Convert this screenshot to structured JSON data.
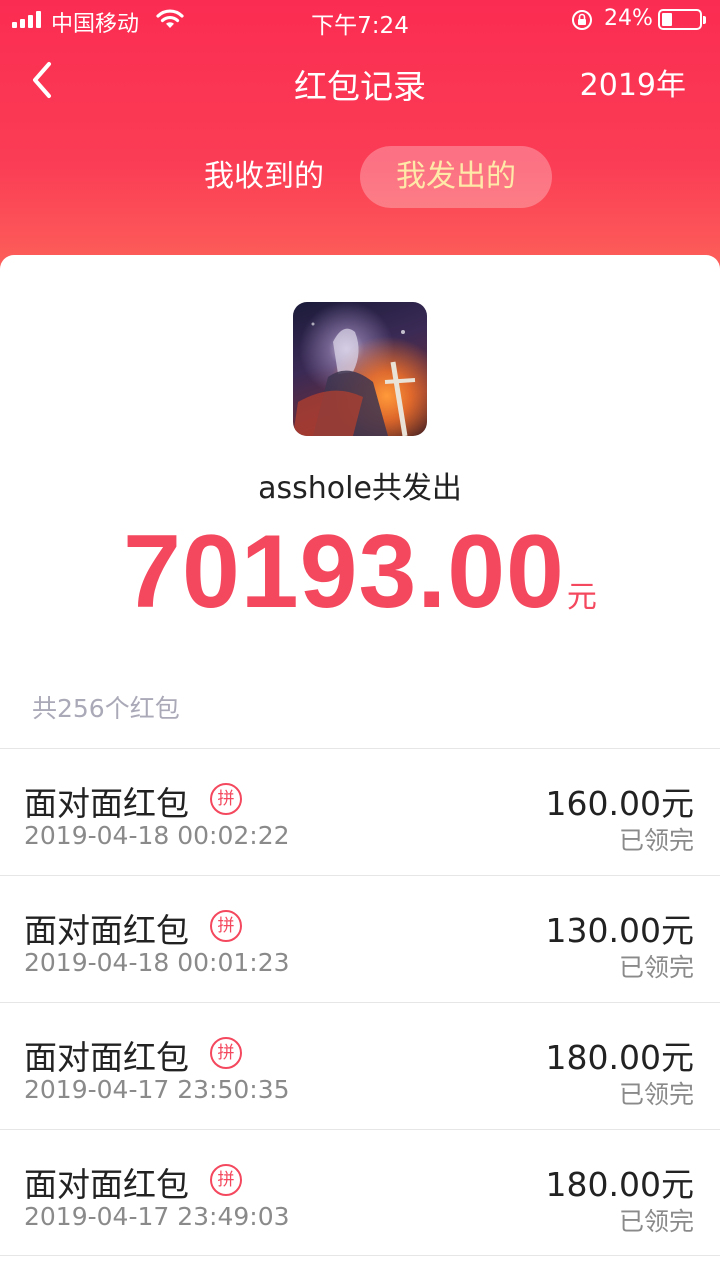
{
  "status_bar": {
    "carrier": "中国移动",
    "time": "下午7:24",
    "battery_pct": "24%"
  },
  "nav": {
    "title": "红包记录",
    "year": "2019年"
  },
  "tabs": {
    "received": "我收到的",
    "sent": "我发出的",
    "active": "sent"
  },
  "summary": {
    "sender_line": "asshole共发出",
    "total_amount": "70193.00",
    "total_unit": "元",
    "count_text": "共256个红包"
  },
  "records": [
    {
      "title": "面对面红包",
      "badge": "拼",
      "time": "2019-04-18 00:02:22",
      "amount": "160.00元",
      "status": "已领完"
    },
    {
      "title": "面对面红包",
      "badge": "拼",
      "time": "2019-04-18 00:01:23",
      "amount": "130.00元",
      "status": "已领完"
    },
    {
      "title": "面对面红包",
      "badge": "拼",
      "time": "2019-04-17 23:50:35",
      "amount": "180.00元",
      "status": "已领完"
    },
    {
      "title": "面对面红包",
      "badge": "拼",
      "time": "2019-04-17 23:49:03",
      "amount": "180.00元",
      "status": "已领完"
    }
  ],
  "colors": {
    "header_top": "#fb2c52",
    "header_bottom": "#fd6a5b",
    "accent": "#f4485e",
    "active_tab_text": "#ffe9a8"
  },
  "icons": [
    "signal-icon",
    "wifi-icon",
    "rotation-lock-icon",
    "battery-icon",
    "back-chevron-icon",
    "pin-badge-icon"
  ]
}
